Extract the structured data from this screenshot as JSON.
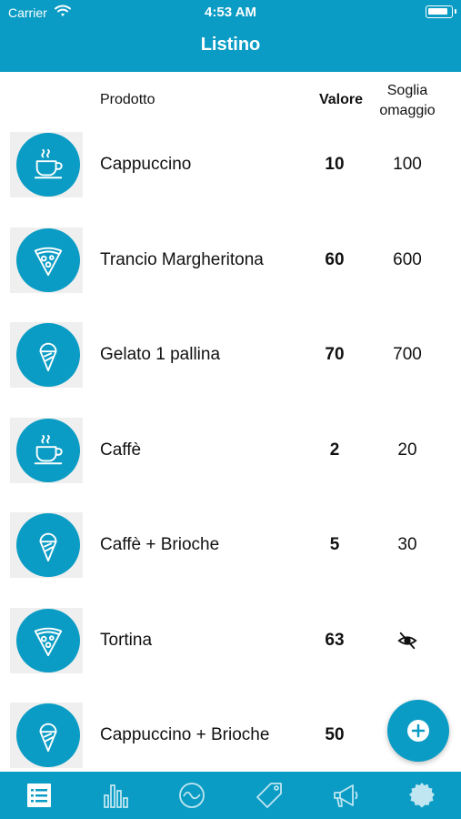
{
  "status_bar": {
    "carrier": "Carrier",
    "time": "4:53 AM"
  },
  "nav": {
    "title": "Listino"
  },
  "columns": {
    "product": "Prodotto",
    "value": "Valore",
    "threshold_line1": "Soglia",
    "threshold_line2": "omaggio"
  },
  "products": [
    {
      "icon": "coffee-cup-icon",
      "name": "Cappuccino",
      "value": "10",
      "threshold": "100"
    },
    {
      "icon": "pizza-slice-icon",
      "name": "Trancio Margheritona",
      "value": "60",
      "threshold": "600"
    },
    {
      "icon": "ice-cream-icon",
      "name": "Gelato 1 pallina",
      "value": "70",
      "threshold": "700"
    },
    {
      "icon": "coffee-cup-icon",
      "name": "Caffè",
      "value": "2",
      "threshold": "20"
    },
    {
      "icon": "ice-cream-icon",
      "name": "Caffè + Brioche",
      "value": "5",
      "threshold": "30"
    },
    {
      "icon": "pizza-slice-icon",
      "name": "Tortina",
      "value": "63",
      "threshold": ""
    },
    {
      "icon": "ice-cream-icon",
      "name": "Cappuccino + Brioche",
      "value": "50",
      "threshold": ""
    }
  ],
  "tabs": [
    "list-icon",
    "bar-chart-icon",
    "pulse-icon",
    "tag-icon",
    "megaphone-icon",
    "badge-icon"
  ],
  "colors": {
    "accent": "#0a9cc4",
    "thumb_bg": "#efefef"
  }
}
